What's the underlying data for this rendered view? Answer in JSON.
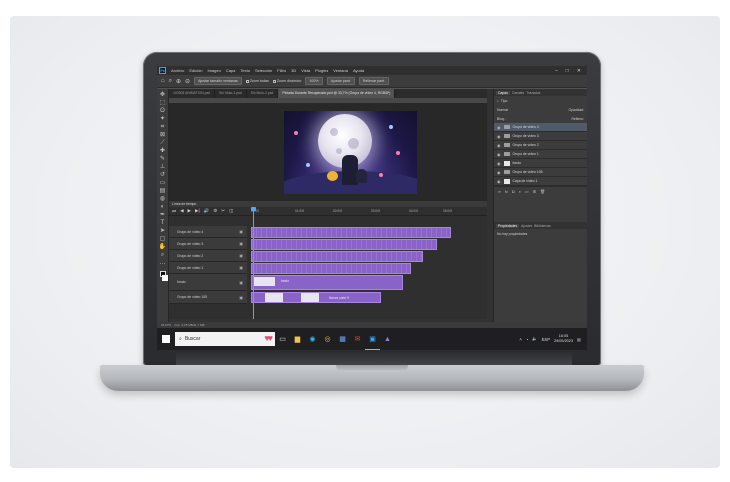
{
  "menubar": {
    "logo": "Ps",
    "items": [
      "Archivo",
      "Edición",
      "Imagen",
      "Capa",
      "Texto",
      "Selección",
      "Filtro",
      "3D",
      "Vista",
      "Plugins",
      "Ventana",
      "Ayuda"
    ],
    "window_controls": [
      "–",
      "□",
      "✕"
    ]
  },
  "options_bar": {
    "home_icon": "home-icon",
    "zoom_icon": "zoom-icon",
    "button1": "Ajustar tamaño ventanas",
    "check1": "Zoom todas",
    "check2": "Zoom dinámico",
    "zoom_value": "100%",
    "button2": "Ajustar pant.",
    "button3": "Rellenar pant."
  },
  "document_tabs": [
    "100305 ANIMATION.psd",
    "Sin título-1.psd",
    "Sin título-2.psd",
    "Pintada Durante Recuperado.psd @ 33,7% (Grupo de vídeo 4, RGB/8*)"
  ],
  "right_panel": {
    "tabs": [
      "Capas",
      "Canales",
      "Trazados"
    ],
    "active_tab": "Capas",
    "kind_label": "Tipo",
    "mode_label": "Normal",
    "opacity_label": "Opacidad:",
    "lock_label": "Bloq.:",
    "fill_label": "Relleno:",
    "layers": [
      {
        "name": "Grupo de vídeo 4",
        "type": "folder",
        "selected": true
      },
      {
        "name": "Grupo de vídeo 3",
        "type": "folder",
        "selected": false
      },
      {
        "name": "Grupo de vídeo 2",
        "type": "folder",
        "selected": false
      },
      {
        "name": "Grupo de vídeo 1",
        "type": "folder",
        "selected": false
      },
      {
        "name": "fondo",
        "type": "layer",
        "selected": false
      },
      {
        "name": "Grupo de vídeo 105",
        "type": "folder",
        "selected": false
      },
      {
        "name": "Capa de vídeo 1",
        "type": "layer",
        "selected": false
      }
    ],
    "properties_tabs": [
      "Propiedades",
      "Ajustes",
      "Bibliotecas"
    ],
    "properties_text": "No hay propiedades"
  },
  "timeline": {
    "title": "Línea de tiempo",
    "ruler_marks": [
      "00:00",
      "01:00f",
      "02:00f",
      "03:00f",
      "04:00f",
      "05:00f"
    ],
    "tracks": [
      {
        "label": "Grupo de vídeo 4"
      },
      {
        "label": "Grupo de vídeo 3"
      },
      {
        "label": "Grupo de vídeo 2"
      },
      {
        "label": "Grupo de vídeo 1"
      },
      {
        "label": "fondo"
      },
      {
        "label": "Grupo de vídeo 105"
      }
    ],
    "clip_labels": [
      "fondo",
      "Nuevo corte 9"
    ],
    "current_time": "0:00:00:00",
    "fps": "(25,00 fps)"
  },
  "status": {
    "zoom": "33,67%",
    "doc": "Doc: 2,25 MB/11,7 MB"
  },
  "taskbar": {
    "search_placeholder": "Buscar",
    "apps": [
      "task-view-icon",
      "folder-icon",
      "edge-icon",
      "chrome-icon",
      "photoshop-icon",
      "mail-icon",
      "store-icon",
      "media-icon"
    ],
    "time": "16:05",
    "date": "29/05/2023",
    "lang": "ESP"
  }
}
